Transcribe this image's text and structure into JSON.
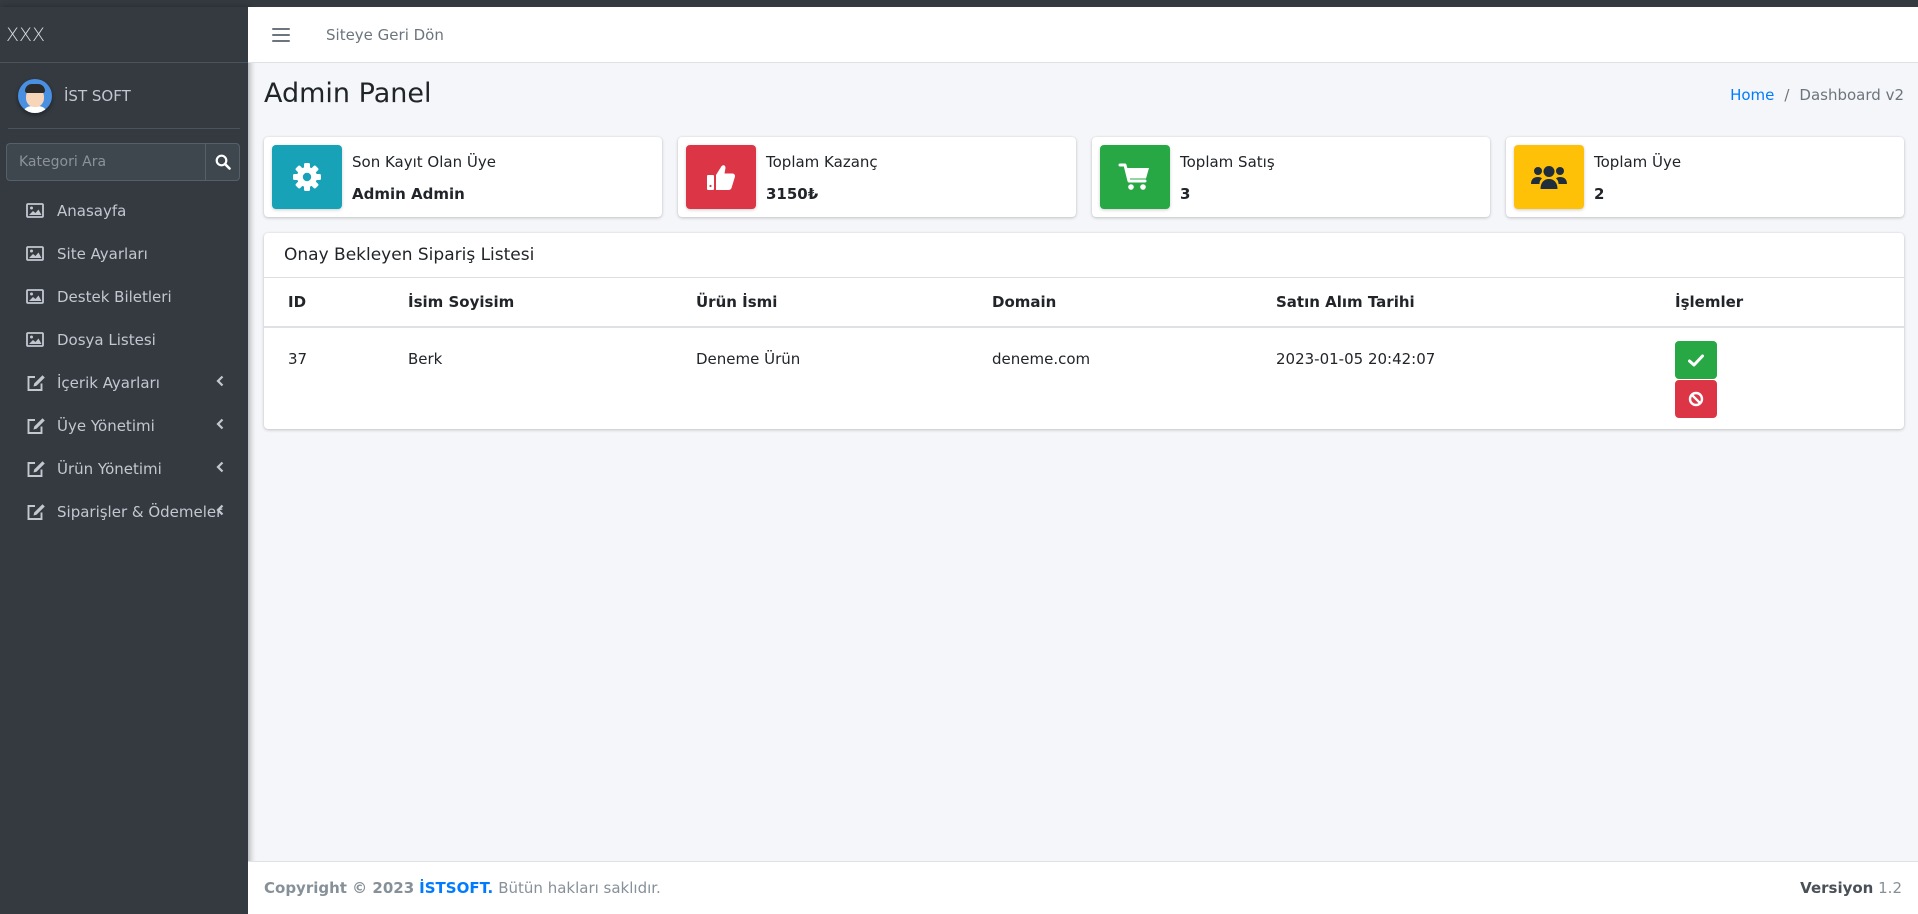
{
  "brand": {
    "title": "XXX"
  },
  "user": {
    "name": "İST SOFT"
  },
  "search": {
    "placeholder": "Kategori Ara"
  },
  "sidebar": {
    "items": [
      {
        "label": "Anasayfa",
        "icon": "image-icon",
        "has_children": false
      },
      {
        "label": "Site Ayarları",
        "icon": "image-icon",
        "has_children": false
      },
      {
        "label": "Destek Biletleri",
        "icon": "image-icon",
        "has_children": false
      },
      {
        "label": "Dosya Listesi",
        "icon": "image-icon",
        "has_children": false
      },
      {
        "label": "İçerik Ayarları",
        "icon": "edit-icon",
        "has_children": true
      },
      {
        "label": "Üye Yönetimi",
        "icon": "edit-icon",
        "has_children": true
      },
      {
        "label": "Ürün Yönetimi",
        "icon": "edit-icon",
        "has_children": true
      },
      {
        "label": "Siparişler & Ödemeler",
        "icon": "edit-icon",
        "has_children": true
      }
    ]
  },
  "navbar": {
    "back_link": "Siteye Geri Dön"
  },
  "header": {
    "title": "Admin Panel",
    "breadcrumb": {
      "home": "Home",
      "separator": "/",
      "current": "Dashboard v2"
    }
  },
  "info_boxes": [
    {
      "label": "Son Kayıt Olan Üye",
      "value": "Admin Admin",
      "color": "#17a2b8",
      "icon": "gear-icon"
    },
    {
      "label": "Toplam Kazanç",
      "value": "3150₺",
      "color": "#dc3545",
      "icon": "thumbs-up-icon"
    },
    {
      "label": "Toplam Satış",
      "value": "3",
      "color": "#28a745",
      "icon": "cart-icon"
    },
    {
      "label": "Toplam Üye",
      "value": "2",
      "color": "#ffc107",
      "icon": "users-icon"
    }
  ],
  "orders": {
    "title": "Onay Bekleyen Sipariş Listesi",
    "columns": [
      "ID",
      "İsim Soyisim",
      "Ürün İsmi",
      "Domain",
      "Satın Alım Tarihi",
      "İşlemler"
    ],
    "rows": [
      {
        "id": "37",
        "name": "Berk",
        "product": "Deneme Ürün",
        "domain": "deneme.com",
        "date": "2023-01-05 20:42:07"
      }
    ],
    "approve_color": "#28a745",
    "reject_color": "#dc3545"
  },
  "footer": {
    "copyright": "Copyright © 2023",
    "brand": "İSTSOFT.",
    "rights": "Bütün hakları saklıdır.",
    "version_label": "Versiyon",
    "version_number": "1.2"
  }
}
